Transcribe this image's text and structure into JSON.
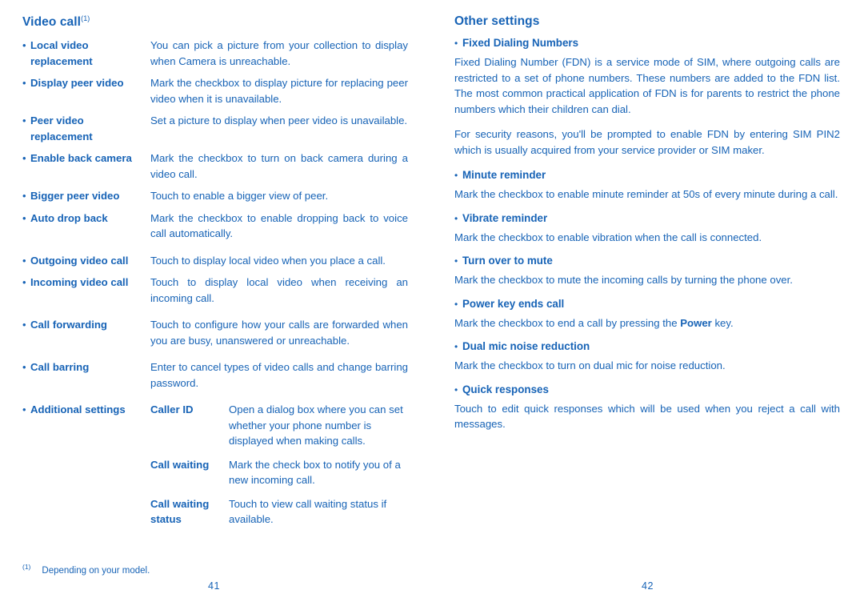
{
  "left": {
    "title": "Video call",
    "title_sup": "(1)",
    "bullet": "•",
    "entries": [
      {
        "term": "Local video replacement",
        "desc": "You can pick a picture from your collection to display when Camera is unreachable."
      },
      {
        "term": "Display peer video",
        "desc": "Mark the checkbox to display picture for replacing peer video when it is unavailable."
      },
      {
        "term": "Peer video replacement",
        "desc": "Set a picture to display when peer video is unavailable."
      },
      {
        "term": "Enable back camera",
        "desc": "Mark the checkbox to turn on back camera during a video call."
      },
      {
        "term": "Bigger peer video",
        "desc": "Touch to enable a bigger view of peer."
      },
      {
        "term": "Auto drop back",
        "desc": "Mark the checkbox to enable dropping back to voice call automatically."
      },
      {
        "term": "Outgoing video call",
        "desc": "Touch to display local video when you place a call."
      },
      {
        "term": "Incoming video call",
        "desc": "Touch to display local video when receiving an incoming call."
      },
      {
        "term": "Call forwarding",
        "desc": "Touch to configure how your calls are forwarded when you are busy, unanswered or unreachable."
      },
      {
        "term": "Call barring",
        "desc": "Enter to cancel types of video calls and change barring password."
      }
    ],
    "additional": {
      "term": "Additional settings",
      "subentries": [
        {
          "subterm": "Caller ID",
          "subdesc": "Open a dialog box where you can set whether your phone number is displayed when making calls."
        },
        {
          "subterm": "Call waiting",
          "subdesc": "Mark the check box to notify you of a new incoming call."
        },
        {
          "subterm": "Call waiting status",
          "subdesc": "Touch to view call waiting status if available."
        }
      ]
    },
    "footnote_mark": "(1)",
    "footnote_text": "Depending on your model.",
    "page_number": "41"
  },
  "right": {
    "title": "Other settings",
    "bullet": "•",
    "sections": [
      {
        "heading": "Fixed Dialing Numbers",
        "paragraphs": [
          "Fixed Dialing Number (FDN) is a service mode of SIM, where outgoing calls are restricted to a set of phone numbers. These numbers are added to the FDN list. The most common practical application of FDN is for parents to restrict the phone numbers which their children can dial.",
          "For security reasons, you'll be prompted to enable FDN by entering SIM PIN2 which is usually acquired from your service provider or SIM maker."
        ]
      },
      {
        "heading": "Minute reminder",
        "paragraphs": [
          "Mark the checkbox to enable minute reminder at 50s of every minute during a call."
        ]
      },
      {
        "heading": "Vibrate reminder",
        "paragraphs": [
          "Mark the checkbox to enable vibration when the call is connected."
        ]
      },
      {
        "heading": "Turn over to mute",
        "paragraphs": [
          "Mark the checkbox to mute the incoming calls by turning the phone over."
        ]
      },
      {
        "heading": "Power key ends call",
        "paragraphs": []
      },
      {
        "heading": "Dual mic noise reduction",
        "paragraphs": [
          "Mark the checkbox to turn on dual mic for noise reduction."
        ]
      },
      {
        "heading": "Quick responses",
        "paragraphs": [
          "Touch to edit quick responses which will be used when you reject a call with messages."
        ]
      }
    ],
    "power_key_text_before": "Mark the checkbox to end a call by pressing the ",
    "power_key_bold": "Power",
    "power_key_text_after": " key.",
    "page_number": "42"
  },
  "colors": {
    "text": "#1763b6",
    "background": "#ffffff"
  }
}
